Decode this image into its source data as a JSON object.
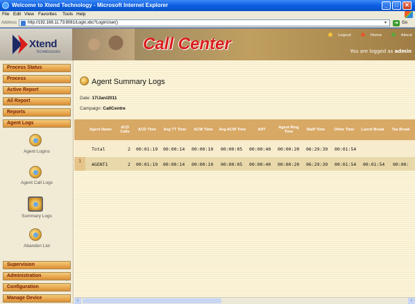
{
  "window": {
    "title": "Welcome to Xtend Technology - Microsoft Internet Explorer",
    "min_glyph": "_",
    "max_glyph": "□",
    "close_glyph": "✕"
  },
  "menubar": {
    "items": [
      "File",
      "Edit",
      "View",
      "Favorites",
      "Tools",
      "Help"
    ]
  },
  "addressbar": {
    "label": "Address",
    "url": "http://192.168.11.73:8081/Login.xbc?LoginUser()",
    "dropdown_glyph": "▾",
    "go_glyph": "➜",
    "go_label": "Go"
  },
  "header": {
    "brand": "Xtend",
    "brand_sub": "TECHNOLOGIES",
    "app_title": "Call Center",
    "links": {
      "logout": "Logout",
      "home": "Home",
      "about": "About"
    },
    "logged_in_prefix": "You are logged as",
    "logged_in_user": "admin"
  },
  "sidebar": {
    "top_items": [
      "Process Status",
      "Process",
      "Active Report",
      "All Report",
      "Reports",
      "Agent Logs"
    ],
    "sub_items": [
      "Agent Logins",
      "Agent Call Logs",
      "Summary Logs",
      "Abandon List"
    ],
    "bottom_items": [
      "Supervision",
      "Administration",
      "Configuration",
      "Manage Device"
    ]
  },
  "main": {
    "title": "Agent Summary Logs",
    "date_label": "Date:",
    "date_value": "17/Jan/2011",
    "campaign_label": "Campaign:",
    "campaign_value": "CallCentre",
    "columns": [
      "Agent Name",
      "ACD Calls",
      "ACD Time",
      "Avg TT Time",
      "ACW Time",
      "Avg ACW Time",
      "AHT",
      "Agent Ring Time",
      "Staff Time",
      "Other Time",
      "Lunch Break",
      "Tea Break"
    ],
    "rows": [
      {
        "num": "",
        "cells": [
          "Total",
          "2",
          "00:01:19",
          "00:00:14",
          "00:00:10",
          "00:00:05",
          "00:00:40",
          "00:00:20",
          "06:29:39",
          "00:01:54",
          "",
          ""
        ]
      },
      {
        "num": "1",
        "cells": [
          "AGENT1",
          "2",
          "00:01:19",
          "00:00:14",
          "00:00:10",
          "00:00:05",
          "00:00:40",
          "00:00:20",
          "06:29:39",
          "00:01:54",
          "00:01:54",
          "00:00:"
        ]
      }
    ]
  },
  "colors": {
    "accent": "#dd8e32",
    "header_row": "#d8a865",
    "title_red": "#d91c1c",
    "ie_blue": "#0a5ee0"
  }
}
